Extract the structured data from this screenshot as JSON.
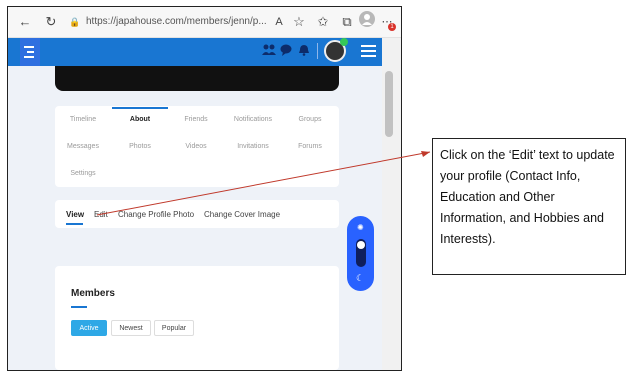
{
  "browser": {
    "url": "https://japahouse.com/members/jenn/p...",
    "back_glyph": "←",
    "reload_glyph": "↻",
    "lock_glyph": "🔒",
    "read_glyph": "A",
    "badge_count": "1"
  },
  "header": {
    "icons": [
      "users-icon",
      "chat-icon",
      "bell-icon"
    ]
  },
  "profile_tabs": [
    {
      "label": "Timeline"
    },
    {
      "label": "About"
    },
    {
      "label": "Friends"
    },
    {
      "label": "Notifications"
    },
    {
      "label": "Groups"
    },
    {
      "label": "Messages"
    },
    {
      "label": "Photos"
    },
    {
      "label": "Videos"
    },
    {
      "label": "Invitations"
    },
    {
      "label": "Forums"
    },
    {
      "label": "Settings"
    }
  ],
  "subnav": {
    "view": "View",
    "edit": "Edit",
    "change_profile_photo": "Change Profile Photo",
    "change_cover_image": "Change Cover Image"
  },
  "members": {
    "title": "Members",
    "filters": [
      "Active",
      "Newest",
      "Popular"
    ]
  },
  "callout": {
    "text": "Click on the ‘Edit’ text to update your profile (Contact Info, Education and Other Information, and Hobbies and Interests)."
  },
  "colors": {
    "header_blue": "#1976d2",
    "accent_blue": "#2962ff",
    "active_filter": "#2ea8e6",
    "arrow_red": "#c0392b"
  }
}
